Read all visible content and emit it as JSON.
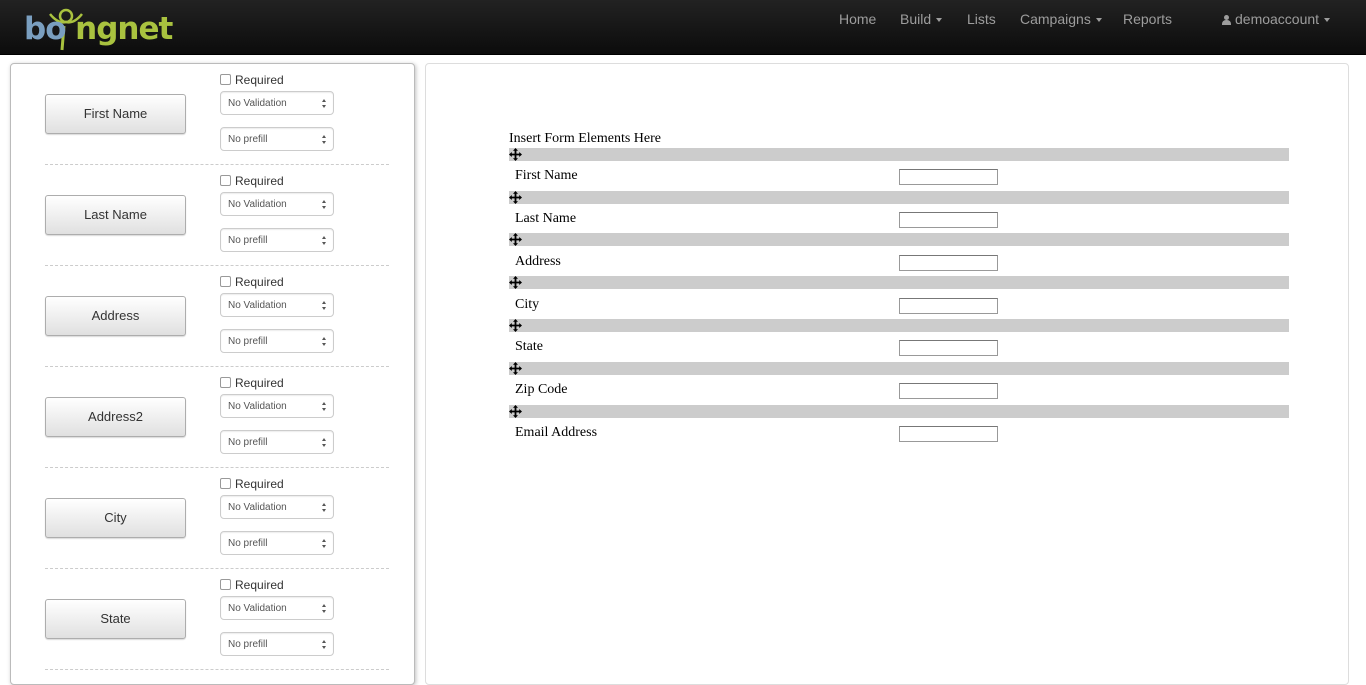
{
  "brand": {
    "logo_part1": "bo",
    "logo_part2": "i",
    "logo_part3": "ng",
    "logo_part4": "net",
    "logo_colors": {
      "blue": "#7a9fc0",
      "green": "#a9c23f"
    }
  },
  "nav": {
    "home": "Home",
    "build": "Build",
    "lists": "Lists",
    "campaigns": "Campaigns",
    "reports": "Reports",
    "account": "demoaccount"
  },
  "left_panel": {
    "required_label": "Required",
    "validation_default": "No Validation",
    "prefill_default": "No prefill",
    "fields": [
      {
        "label": "First Name"
      },
      {
        "label": "Last Name"
      },
      {
        "label": "Address"
      },
      {
        "label": "Address2"
      },
      {
        "label": "City"
      },
      {
        "label": "State"
      }
    ]
  },
  "form_builder": {
    "title": "Insert Form Elements Here",
    "elements": [
      {
        "label": "First Name"
      },
      {
        "label": "Last Name"
      },
      {
        "label": "Address"
      },
      {
        "label": "City"
      },
      {
        "label": "State"
      },
      {
        "label": "Zip Code"
      },
      {
        "label": "Email Address"
      }
    ]
  }
}
